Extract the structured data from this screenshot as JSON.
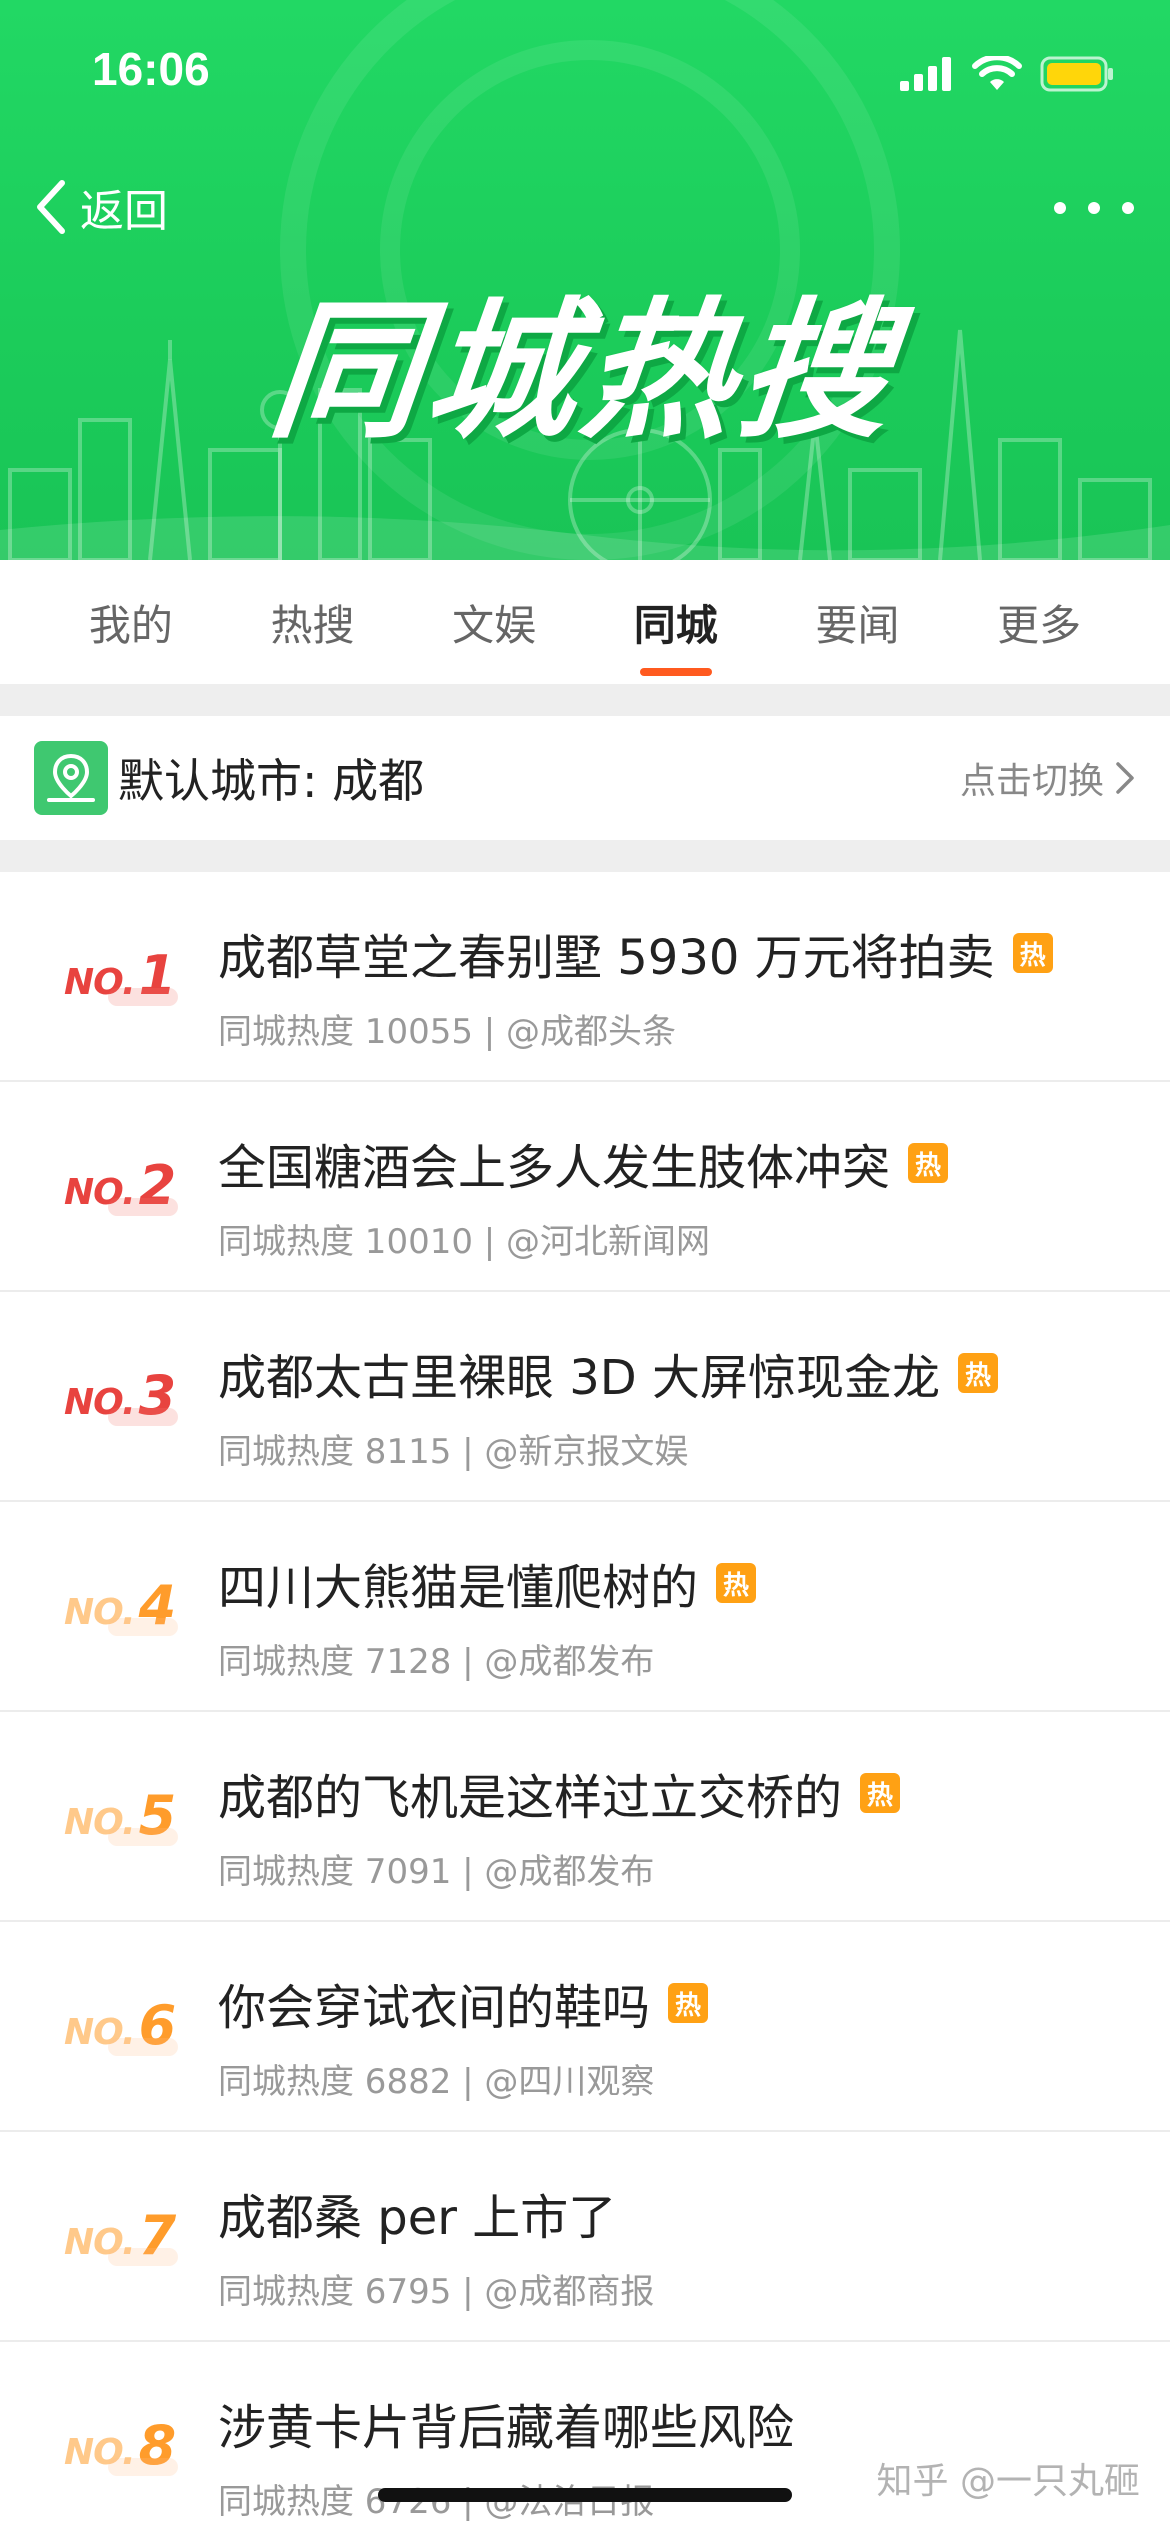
{
  "status_bar": {
    "time": "16:06",
    "battery_color": "#ffd60a"
  },
  "header": {
    "back_label": "返回",
    "banner_title": "同城热搜",
    "colors": {
      "banner": "#1ccd5b",
      "accent": "#ff5a1f"
    }
  },
  "tabs": [
    {
      "label": "我的",
      "active": false
    },
    {
      "label": "热搜",
      "active": false
    },
    {
      "label": "文娱",
      "active": false
    },
    {
      "label": "同城",
      "active": true
    },
    {
      "label": "要闻",
      "active": false
    },
    {
      "label": "更多",
      "active": false
    }
  ],
  "city": {
    "label": "默认城市: 成都",
    "switch_label": "点击切换"
  },
  "hot_badge_label": "热",
  "items": [
    {
      "no": "NO.",
      "rank": "1",
      "title": "成都草堂之春别墅 5930 万元将拍卖",
      "hot": true,
      "meta": "同城热度 10055 | @成都头条"
    },
    {
      "no": "NO.",
      "rank": "2",
      "title": "全国糖酒会上多人发生肢体冲突",
      "hot": true,
      "meta": "同城热度 10010 | @河北新闻网"
    },
    {
      "no": "NO.",
      "rank": "3",
      "title": "成都太古里裸眼 3D 大屏惊现金龙",
      "hot": true,
      "meta": "同城热度 8115 | @新京报文娱"
    },
    {
      "no": "NO.",
      "rank": "4",
      "title": "四川大熊猫是懂爬树的",
      "hot": true,
      "meta": "同城热度 7128 | @成都发布"
    },
    {
      "no": "NO.",
      "rank": "5",
      "title": "成都的飞机是这样过立交桥的",
      "hot": true,
      "meta": "同城热度 7091 | @成都发布"
    },
    {
      "no": "NO.",
      "rank": "6",
      "title": "你会穿试衣间的鞋吗",
      "hot": true,
      "meta": "同城热度 6882 | @四川观察"
    },
    {
      "no": "NO.",
      "rank": "7",
      "title": "成都桑 per 上市了",
      "hot": false,
      "meta": "同城热度 6795 | @成都商报"
    },
    {
      "no": "NO.",
      "rank": "8",
      "title": "涉黄卡片背后藏着哪些风险",
      "hot": false,
      "meta": "同城热度 6726 | @法治日报"
    }
  ],
  "watermark": "知乎 @一只丸砸"
}
